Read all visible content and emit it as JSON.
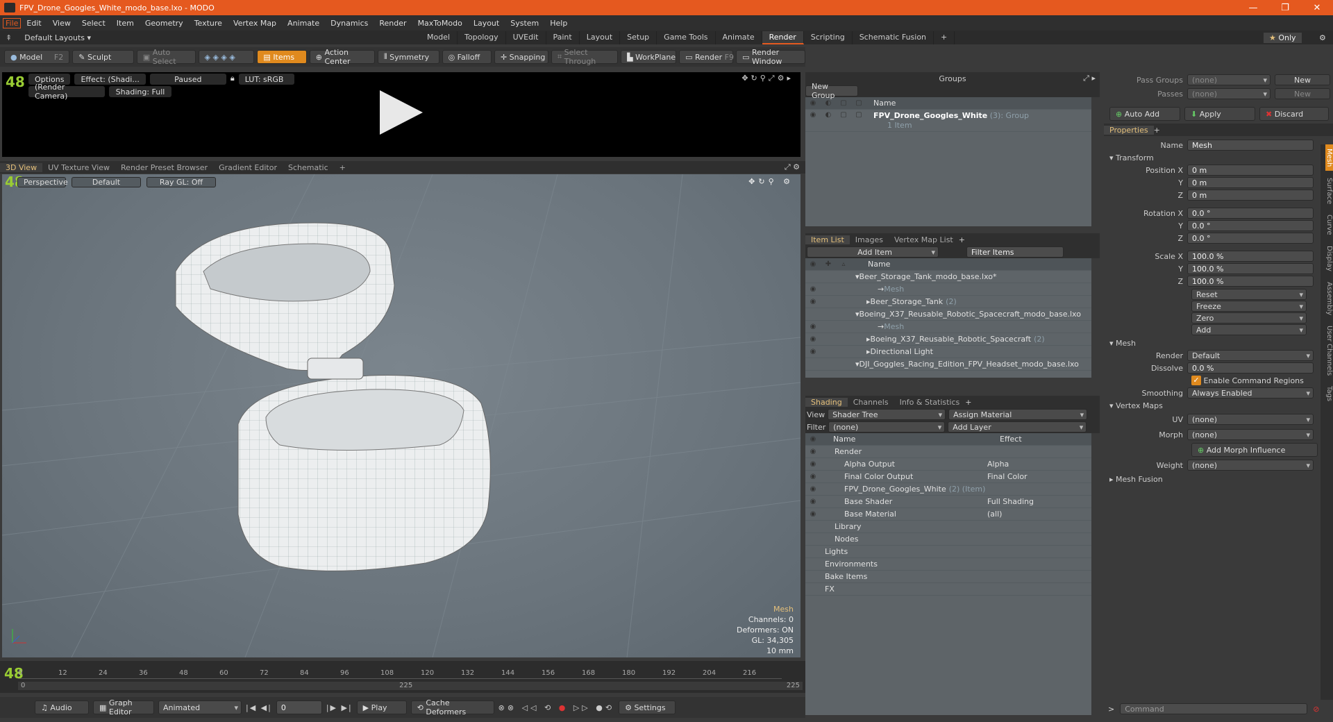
{
  "title": "FPV_Drone_Googles_White_modo_base.lxo - MODO",
  "menu": [
    "File",
    "Edit",
    "View",
    "Select",
    "Item",
    "Geometry",
    "Texture",
    "Vertex Map",
    "Animate",
    "Dynamics",
    "Render",
    "MaxToModo",
    "Layout",
    "System",
    "Help"
  ],
  "layouts": {
    "label": "Default Layouts",
    "only_label": "Only",
    "tabs": [
      "Model",
      "Topology",
      "UVEdit",
      "Paint",
      "Layout",
      "Setup",
      "Game Tools",
      "Animate",
      "Render",
      "Scripting",
      "Schematic Fusion"
    ],
    "active": "Render"
  },
  "toolbar": {
    "model": "Model",
    "model_key": "F2",
    "sculpt": "Sculpt",
    "auto_select": "Auto Select",
    "items": "Items",
    "action_center": "Action Center",
    "symmetry": "Symmetry",
    "falloff": "Falloff",
    "snapping": "Snapping",
    "select_through": "Select Through",
    "workplane": "WorkPlane",
    "render": "Render",
    "render_key": "F9",
    "render_window": "Render Window"
  },
  "render_bar": {
    "options": "Options",
    "effect": "Effect: (Shadi...",
    "paused": "Paused",
    "lut": "LUT: sRGB",
    "camera": "(Render Camera)",
    "shading": "Shading: Full"
  },
  "view_tabs": [
    "3D View",
    "UV Texture View",
    "Render Preset Browser",
    "Gradient Editor",
    "Schematic"
  ],
  "viewport": {
    "perspective": "Perspective",
    "default": "Default",
    "raygl": "Ray GL: Off",
    "fps": "48",
    "info_title": "Mesh",
    "info_lines": [
      "Channels: 0",
      "Deformers: ON",
      "GL: 34,305",
      "10 mm"
    ]
  },
  "timeline": {
    "ticks": [
      "0",
      "12",
      "24",
      "36",
      "48",
      "60",
      "72",
      "84",
      "96",
      "108",
      "120",
      "132",
      "144",
      "156",
      "168",
      "180",
      "192",
      "204",
      "216"
    ],
    "start": "0",
    "mid": "225",
    "end": "225",
    "current": "0"
  },
  "bottom": {
    "audio": "Audio",
    "graph_editor": "Graph Editor",
    "animated": "Animated",
    "frame": "0",
    "play": "Play",
    "cache": "Cache Deformers",
    "settings": "Settings"
  },
  "groups": {
    "title": "Groups",
    "new_group": "New Group",
    "col_name": "Name",
    "item_name": "FPV_Drone_Googles_White",
    "item_count": "(3)",
    "item_type": ": Group",
    "item_sub": "1 Item"
  },
  "itemlist": {
    "tabs": [
      "Item List",
      "Images",
      "Vertex Map List"
    ],
    "add_item": "Add Item",
    "filter": "Filter Items",
    "col_name": "Name",
    "rows": [
      {
        "name": "Beer_Storage_Tank_modo_base.lxo*",
        "indent": 0,
        "dim": false
      },
      {
        "name": "Mesh",
        "indent": 2,
        "dim": true
      },
      {
        "name": "Beer_Storage_Tank",
        "count": "(2)",
        "indent": 1,
        "dim": false
      },
      {
        "name": "Boeing_X37_Reusable_Robotic_Spacecraft_modo_base.lxo",
        "indent": 0,
        "dim": false
      },
      {
        "name": "Mesh",
        "indent": 2,
        "dim": true
      },
      {
        "name": "Boeing_X37_Reusable_Robotic_Spacecraft",
        "count": "(2)",
        "indent": 1,
        "dim": false
      },
      {
        "name": "Directional Light",
        "indent": 1,
        "dim": false
      },
      {
        "name": "DJI_Goggles_Racing_Edition_FPV_Headset_modo_base.lxo",
        "indent": 0,
        "dim": false
      }
    ]
  },
  "shading": {
    "tabs": [
      "Shading",
      "Channels",
      "Info & Statistics"
    ],
    "view_label": "View",
    "view_value": "Shader Tree",
    "assign": "Assign Material",
    "filter_label": "Filter",
    "filter_value": "(none)",
    "add_layer": "Add Layer",
    "col_name": "Name",
    "col_effect": "Effect",
    "rows": [
      {
        "name": "Render",
        "effect": "",
        "indent": 1
      },
      {
        "name": "Alpha Output",
        "effect": "Alpha",
        "indent": 2
      },
      {
        "name": "Final Color Output",
        "effect": "Final Color",
        "indent": 2
      },
      {
        "name": "FPV_Drone_Googles_White",
        "extra": "(2) (Item)",
        "effect": "",
        "indent": 2
      },
      {
        "name": "Base Shader",
        "effect": "Full Shading",
        "indent": 2
      },
      {
        "name": "Base Material",
        "effect": "(all)",
        "indent": 2
      },
      {
        "name": "Library",
        "effect": "",
        "indent": 1
      },
      {
        "name": "Nodes",
        "effect": "",
        "indent": 1
      },
      {
        "name": "Lights",
        "effect": "",
        "indent": 0
      },
      {
        "name": "Environments",
        "effect": "",
        "indent": 0
      },
      {
        "name": "Bake Items",
        "effect": "",
        "indent": 0
      },
      {
        "name": "FX",
        "effect": "",
        "indent": 0
      }
    ]
  },
  "props": {
    "pass_groups": "Pass Groups",
    "passes": "Passes",
    "none": "(none)",
    "new": "New",
    "auto_add": "Auto Add",
    "apply": "Apply",
    "discard": "Discard",
    "tab": "Properties",
    "name_label": "Name",
    "name_value": "Mesh",
    "transform": "Transform",
    "position": [
      "0 m",
      "0 m",
      "0 m"
    ],
    "rotation": [
      "0.0 °",
      "0.0 °",
      "0.0 °"
    ],
    "scale": [
      "100.0 %",
      "100.0 %",
      "100.0 %"
    ],
    "labels": {
      "px": "Position X",
      "rx": "Rotation X",
      "sx": "Scale X",
      "y": "Y",
      "z": "Z"
    },
    "actions": [
      "Reset",
      "Freeze",
      "Zero",
      "Add"
    ],
    "mesh": "Mesh",
    "render_label": "Render",
    "render_value": "Default",
    "dissolve_label": "Dissolve",
    "dissolve_value": "0.0 %",
    "cmd_regions": "Enable Command Regions",
    "smoothing_label": "Smoothing",
    "smoothing_value": "Always Enabled",
    "vertex_maps": "Vertex Maps",
    "uv_label": "UV",
    "morph_label": "Morph",
    "add_morph": "Add Morph Influence",
    "weight_label": "Weight",
    "mesh_fusion": "Mesh Fusion",
    "command": "Command",
    "side_tabs": [
      "Mesh",
      "Surface",
      "Curve",
      "Display",
      "Assembly",
      "User Channels",
      "Tags"
    ]
  }
}
